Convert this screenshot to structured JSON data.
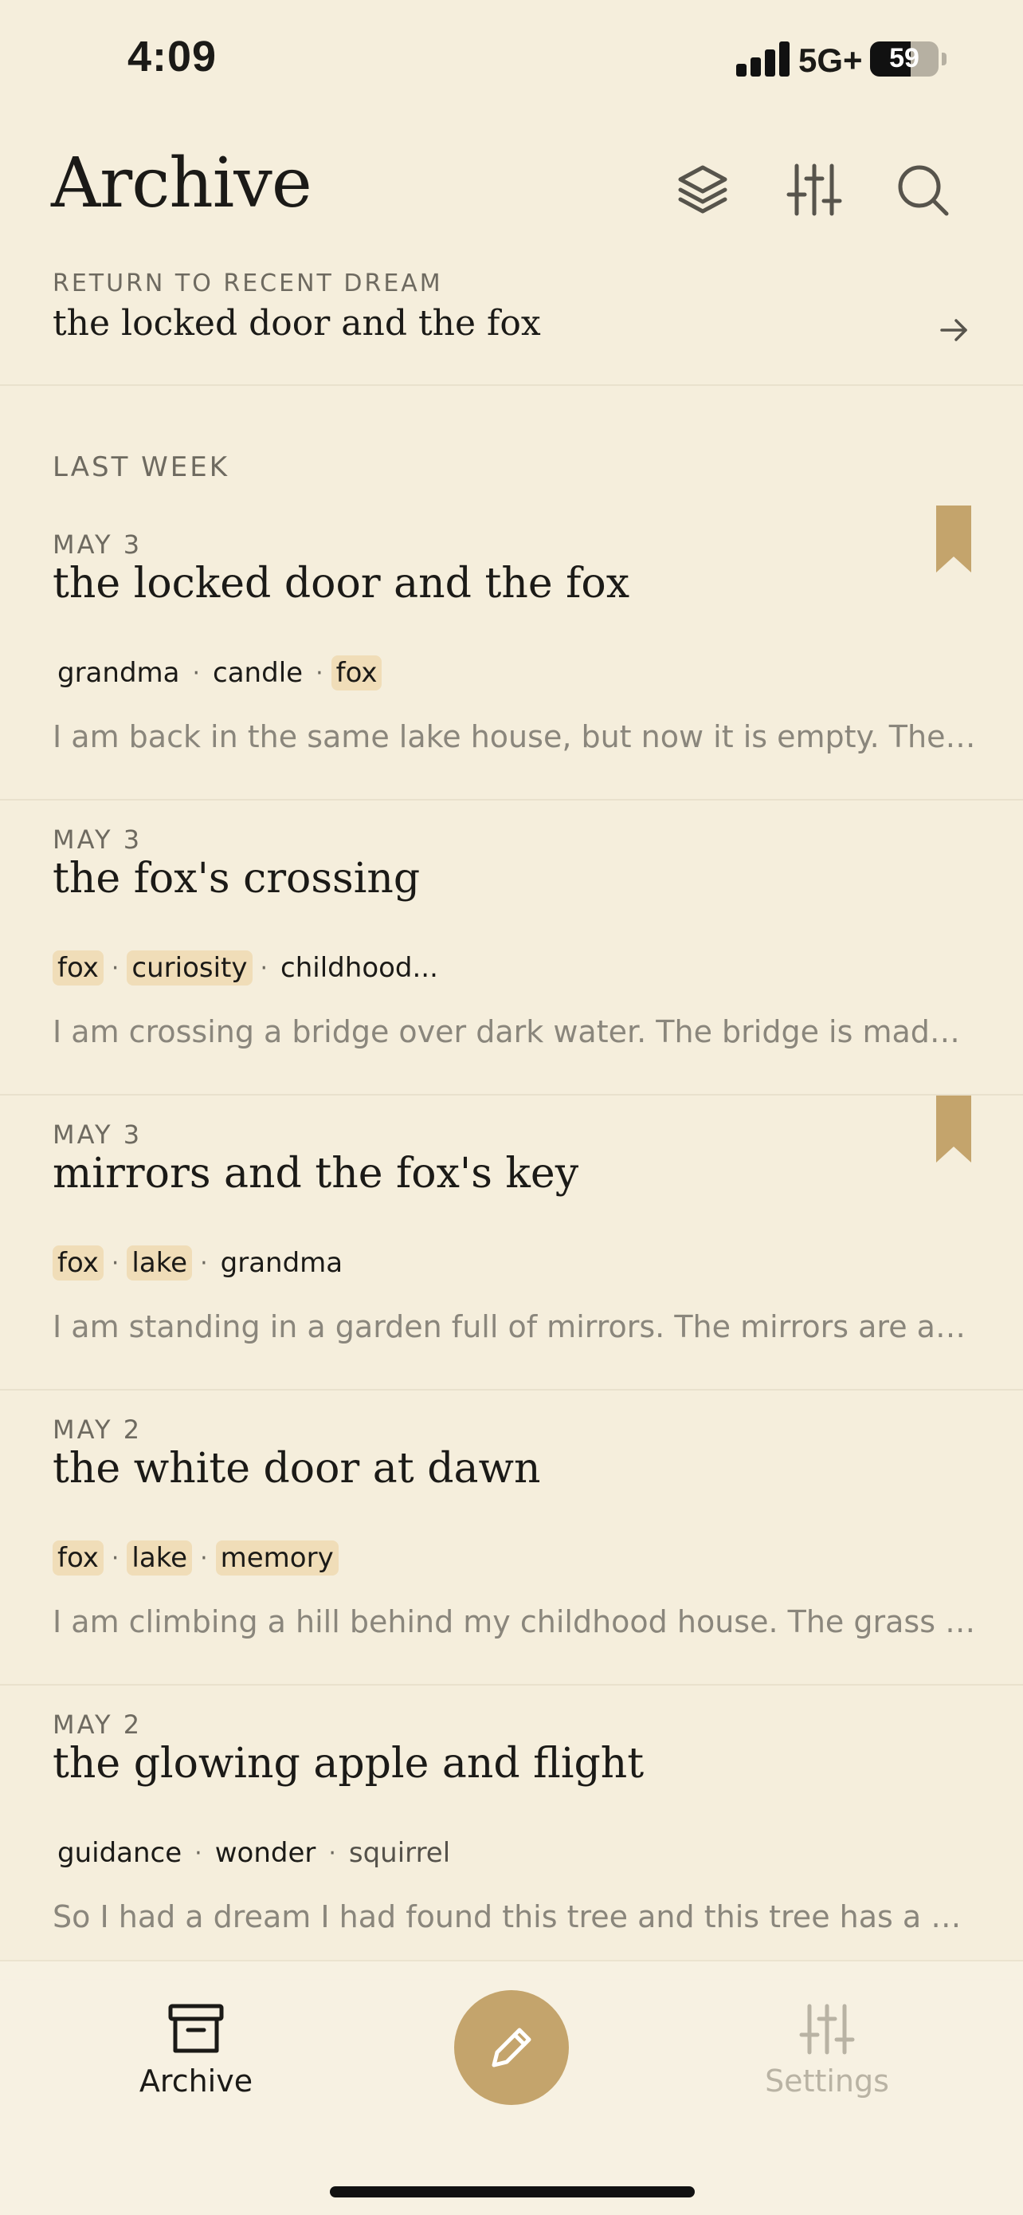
{
  "status_bar": {
    "time": "4:09",
    "network": "5G+",
    "battery": "59",
    "battery_level": 0.59
  },
  "header": {
    "title": "Archive",
    "icons": [
      "layers-icon",
      "filter-sliders-icon",
      "search-icon"
    ]
  },
  "recent": {
    "label": "RETURN TO RECENT DREAM",
    "title": "the locked door and the fox",
    "arrow_icon": "arrow-right-icon"
  },
  "section": {
    "heading": "LAST WEEK"
  },
  "entries": [
    {
      "date": "MAY 3",
      "title": "the locked door and the fox",
      "bookmarked": true,
      "tags": [
        {
          "text": "grandma",
          "highlight": false
        },
        {
          "text": "candle",
          "highlight": false
        },
        {
          "text": "fox",
          "highlight": true
        }
      ],
      "excerpt": "I am back in the same lake house, but now it is empty. The f..."
    },
    {
      "date": "MAY 3",
      "title": "the fox's crossing",
      "bookmarked": false,
      "tags": [
        {
          "text": "fox",
          "highlight": true
        },
        {
          "text": "curiosity",
          "highlight": true
        },
        {
          "text": "childhood...",
          "highlight": false
        }
      ],
      "excerpt": "I am crossing a bridge over dark water. The bridge is made..."
    },
    {
      "date": "MAY 3",
      "title": "mirrors and the fox's key",
      "bookmarked": true,
      "tags": [
        {
          "text": "fox",
          "highlight": true
        },
        {
          "text": "lake",
          "highlight": true
        },
        {
          "text": "grandma",
          "highlight": false
        }
      ],
      "excerpt": "I am standing in a garden full of mirrors. The mirrors are arra..."
    },
    {
      "date": "MAY 2",
      "title": "the white door at dawn",
      "bookmarked": false,
      "tags": [
        {
          "text": "fox",
          "highlight": true
        },
        {
          "text": "lake",
          "highlight": true
        },
        {
          "text": "memory",
          "highlight": true
        }
      ],
      "excerpt": "I am climbing a hill behind my childhood house. The grass is..."
    },
    {
      "date": "MAY 2",
      "title": "the glowing apple and flight",
      "bookmarked": false,
      "tags": [
        {
          "text": "guidance",
          "highlight": false
        },
        {
          "text": "wonder",
          "highlight": false
        },
        {
          "text": "squirrel",
          "highlight": false,
          "dim": true
        }
      ],
      "excerpt": "So I had a dream I had found this tree and this tree has a squ..."
    }
  ],
  "tab_bar": {
    "archive_label": "Archive",
    "settings_label": "Settings",
    "compose_icon": "pencil-icon"
  },
  "colors": {
    "background": "#f5eedc",
    "accent": "#c4a46c",
    "bookmark": "#c4a46c",
    "tag_highlight": "#f0ddb8",
    "muted_text": "#8a867c"
  }
}
